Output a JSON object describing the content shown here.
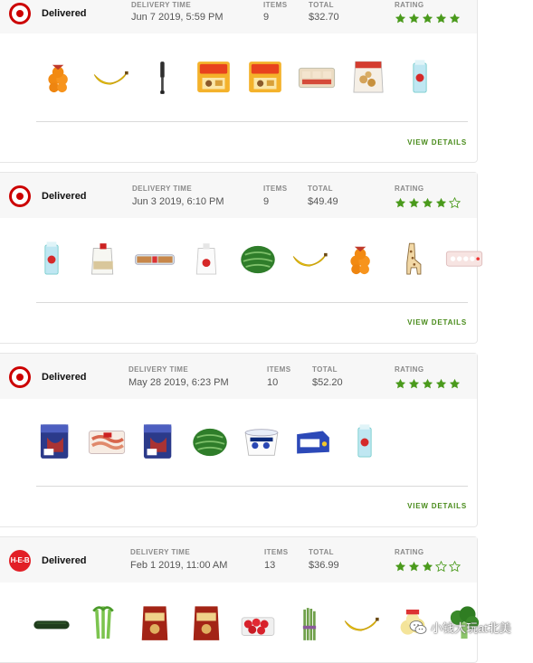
{
  "labels": {
    "delivery_time": "DELIVERY TIME",
    "items": "ITEMS",
    "total": "TOTAL",
    "rating": "RATING",
    "view_details": "VIEW DETAILS"
  },
  "colors": {
    "star_filled": "#4a9a1c",
    "star_empty_stroke": "#4a9a1c",
    "link": "#4a8c1c",
    "target_red": "#cc0000",
    "heb_red": "#e21f26"
  },
  "orders": [
    {
      "store_logo": "target-logo-icon",
      "status": "Delivered",
      "delivery_time": "Jun 7 2019, 5:59 PM",
      "items": "9",
      "total": "$32.70",
      "rating": 5,
      "products": [
        "oranges-bag-icon",
        "banana-icon",
        "spatula-icon",
        "lunchables-pack-icon",
        "lunchables-pack-icon",
        "cookies-tray-icon",
        "snack-bag-icon",
        "milk-carton-icon"
      ]
    },
    {
      "store_logo": "target-logo-icon",
      "status": "Delivered",
      "delivery_time": "Jun 3 2019, 6:10 PM",
      "items": "9",
      "total": "$49.49",
      "rating": 4,
      "products": [
        "milk-carton-icon",
        "milk-gallon-icon",
        "bread-loaf-icon",
        "water-jug-icon",
        "watermelon-icon",
        "banana-icon",
        "oranges-bag-icon",
        "giraffe-toy-icon",
        "egg-carton-icon"
      ]
    },
    {
      "store_logo": "target-logo-icon",
      "status": "Delivered",
      "delivery_time": "May 28 2019, 6:23 PM",
      "items": "10",
      "total": "$52.20",
      "rating": 5,
      "products": [
        "diaper-pack-icon",
        "bacon-pack-icon",
        "diaper-pack-icon",
        "watermelon-icon",
        "yogurt-cup-icon",
        "cheese-box-icon",
        "milk-carton-icon"
      ]
    },
    {
      "store_logo": "heb-logo-icon",
      "store_logo_text": "H‑E‑B",
      "status": "Delivered",
      "delivery_time": "Feb 1 2019, 11:00 AM",
      "items": "13",
      "total": "$36.99",
      "rating": 3,
      "products": [
        "cucumber-icon",
        "celery-icon",
        "chips-bag-icon",
        "chips-bag-icon",
        "strawberries-icon",
        "asparagus-icon",
        "banana-icon",
        "onion-bag-icon",
        "broccoli-icon"
      ]
    }
  ],
  "watermark": "小钱大玩at北美"
}
